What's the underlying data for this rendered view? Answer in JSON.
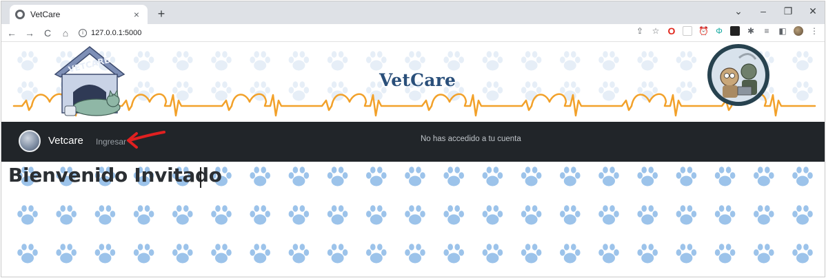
{
  "browser": {
    "tab_title": "VetCare",
    "tab_close": "×",
    "new_tab": "+",
    "url": "127.0.0.1:5000",
    "nav_back": "←",
    "nav_forward": "→",
    "nav_reload": "C",
    "nav_home": "⌂",
    "window_controls": {
      "dropdown": "⌄",
      "minimize": "–",
      "maximize": "❐",
      "close": "✕"
    },
    "extensions": [
      {
        "name": "share-icon",
        "glyph": "⇪"
      },
      {
        "name": "star-bookmark-icon",
        "glyph": "☆"
      },
      {
        "name": "opera-extension-icon",
        "glyph": "O"
      },
      {
        "name": "blank-extension-icon",
        "glyph": ""
      },
      {
        "name": "alarm-extension-icon",
        "glyph": "⏰"
      },
      {
        "name": "teal-extension-icon",
        "glyph": "Φ"
      },
      {
        "name": "dark-extension-icon",
        "glyph": ""
      },
      {
        "name": "puzzle-extensions-icon",
        "glyph": "✱"
      },
      {
        "name": "reading-list-icon",
        "glyph": "≡"
      },
      {
        "name": "side-panel-icon",
        "glyph": "◧"
      },
      {
        "name": "profile-avatar-icon",
        "glyph": ""
      },
      {
        "name": "kebab-menu-icon",
        "glyph": "⋮"
      }
    ]
  },
  "banner": {
    "title": "VetCare"
  },
  "navbar": {
    "brand": "Vetcare",
    "login_link": "Ingresar",
    "status": "No has accedido a tu cuenta"
  },
  "main": {
    "welcome": "Bienvenido Invitado"
  },
  "colors": {
    "navbar_bg": "#212529",
    "paw": "#9cc3ea",
    "paw_faint": "#e6eef7",
    "heartbeat": "#f2a12a",
    "title": "#2a4f7a",
    "annotation_arrow": "#e02020"
  }
}
